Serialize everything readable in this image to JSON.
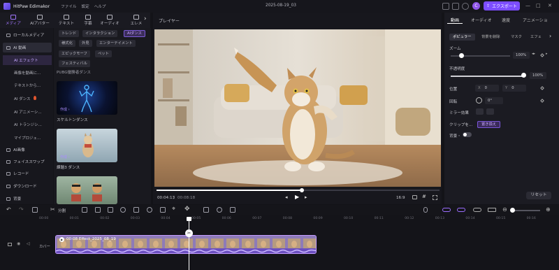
{
  "app": {
    "name": "HitPaw Edimakor",
    "project": "2025-08-19_03",
    "avatar_letter": "C",
    "export_label": "エクスポート"
  },
  "menu": [
    "ファイル",
    "設定",
    "ヘルプ"
  ],
  "toolbar": [
    {
      "label": "メディア",
      "icon": "media-icon"
    },
    {
      "label": "AIアバター",
      "icon": "ai-avatar-icon"
    },
    {
      "label": "テキスト",
      "icon": "text-icon"
    },
    {
      "label": "字幕",
      "icon": "subtitle-icon"
    },
    {
      "label": "オーディオ",
      "icon": "audio-icon"
    },
    {
      "label": "エレメ",
      "icon": "element-icon"
    }
  ],
  "sidebar": {
    "categories": [
      {
        "label": "ローカルメディア",
        "icon": "folder-icon"
      },
      {
        "label": "AI 動画",
        "icon": "ai-video-icon"
      }
    ],
    "sub_items": [
      "AI エフェクト",
      "画像を動画に...",
      "テキストから...",
      "AI ダンス",
      "AI アニメーシ...",
      "AI トランジシ...",
      "マイプロジェ..."
    ],
    "bottom": [
      {
        "label": "AI画像",
        "icon": "ai-image-icon"
      },
      {
        "label": "フェイススワップ",
        "icon": "face-swap-icon"
      },
      {
        "label": "レコード",
        "icon": "record-icon"
      },
      {
        "label": "ダウンロード",
        "icon": "download-icon"
      },
      {
        "label": "背景",
        "icon": "background-icon"
      }
    ]
  },
  "tags": [
    "トレンド",
    "インタラクション",
    "AIダンス",
    "様式化",
    "外見",
    "エンターテイメント",
    "エピックモーフ",
    "ペット",
    "フェスティバル"
  ],
  "assets": {
    "top_label": "PUBG優勝者ダンス",
    "items": [
      {
        "label": "スケルトンダンス",
        "badge": "作成 ›"
      },
      {
        "label": "課題3 ダンス",
        "badge": "作成 ›"
      }
    ]
  },
  "player": {
    "title": "プレイヤー",
    "time_current": "00:04:13",
    "time_total": "00:08:18",
    "aspect": "16:9"
  },
  "inspector": {
    "tabs": [
      "動画",
      "オーディオ",
      "速度",
      "アニメーショ"
    ],
    "subtabs": [
      "ポピュラー",
      "背景を削除",
      "マスク",
      "エフェ"
    ],
    "zoom_label": "ズーム",
    "zoom_value": "100%",
    "zoom_level": 0.1,
    "opacity_label": "不透明度",
    "opacity_value": "100%",
    "opacity_level": 1.0,
    "position_label": "位置",
    "pos_x_label": "X",
    "pos_x": "0",
    "pos_y_label": "Y",
    "pos_y": "0",
    "rotation_label": "回転",
    "rotation_value": "0°",
    "mirror_label": "ミラー効果",
    "clip_label": "クリップを...",
    "replace_label": "置き換え",
    "bg_label": "背景・",
    "reset_label": "リセット"
  },
  "edit_bar": {
    "split_label": "分割"
  },
  "timeline": {
    "ruler": [
      "00:00",
      "00:01",
      "00:02",
      "00:03",
      "00:04",
      "00:05",
      "00:06",
      "00:07",
      "00:08",
      "00:09",
      "00:10",
      "00:11",
      "00:12",
      "00:13",
      "00:14",
      "00:15",
      "00:16"
    ],
    "track_label": "カバー",
    "clip_title": "00:08 Effect_2025_08_19"
  },
  "colors": {
    "accent": "#8b5cf6",
    "export": "#7c4dff",
    "clip": "#7a5cc9"
  }
}
